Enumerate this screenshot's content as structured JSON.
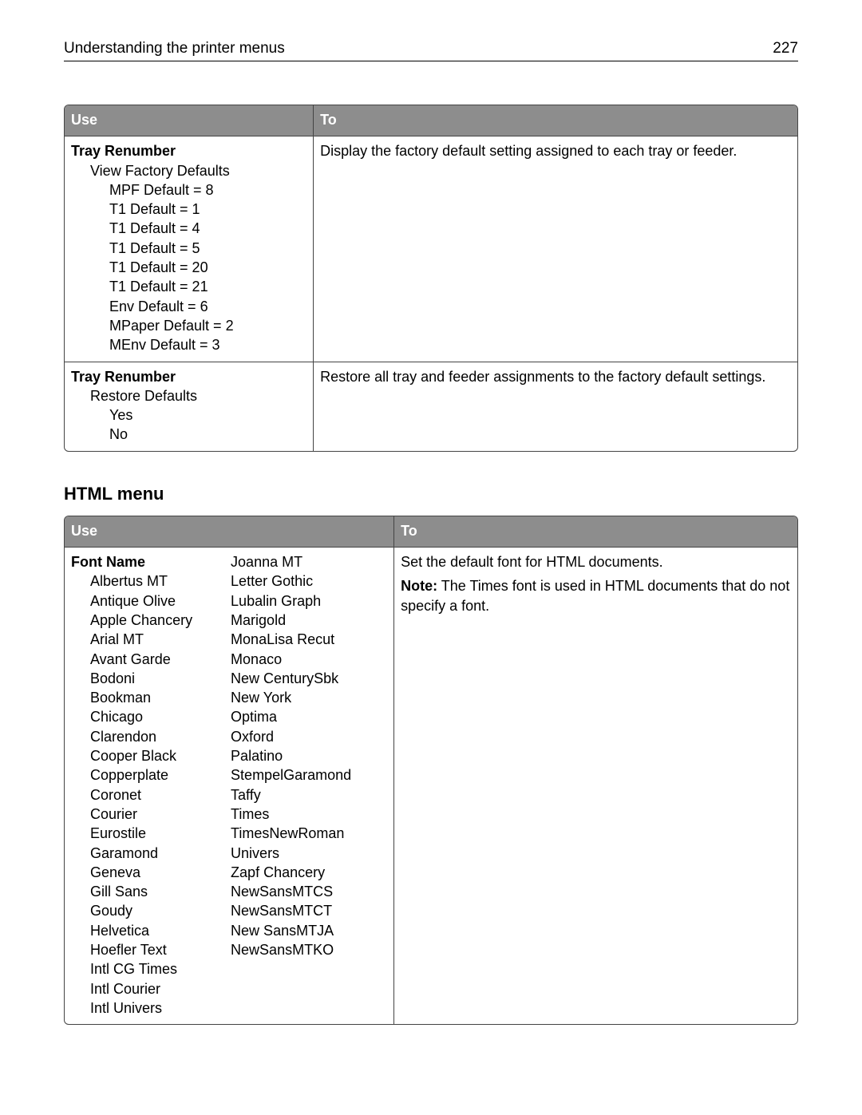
{
  "header": {
    "title": "Understanding the printer menus",
    "page_number": "227"
  },
  "table1": {
    "columns": {
      "use": "Use",
      "to": "To"
    },
    "rows": [
      {
        "use": {
          "title": "Tray Renumber",
          "sub": "View Factory Defaults",
          "items": [
            "MPF Default = 8",
            "T1 Default = 1",
            "T1 Default = 4",
            "T1 Default = 5",
            "T1 Default = 20",
            "T1 Default = 21",
            "Env Default = 6",
            "MPaper Default = 2",
            "MEnv Default = 3"
          ]
        },
        "to": "Display the factory default setting assigned to each tray or feeder."
      },
      {
        "use": {
          "title": "Tray Renumber",
          "sub": "Restore Defaults",
          "items": [
            "Yes",
            "No"
          ]
        },
        "to": "Restore all tray and feeder assignments to the factory default settings."
      }
    ]
  },
  "section2_title": "HTML menu",
  "table2": {
    "columns": {
      "use": "Use",
      "to": "To"
    },
    "row": {
      "use": {
        "title": "Font Name",
        "col1": [
          "Albertus MT",
          "Antique Olive",
          "Apple Chancery",
          "Arial MT",
          "Avant Garde",
          "Bodoni",
          "Bookman",
          "Chicago",
          "Clarendon",
          "Cooper Black",
          "Copperplate",
          "Coronet",
          "Courier",
          "Eurostile",
          "Garamond",
          "Geneva",
          "Gill Sans",
          "Goudy",
          "Helvetica",
          "Hoefler Text",
          "Intl CG Times",
          "Intl Courier",
          "Intl Univers"
        ],
        "col2": [
          "Joanna MT",
          "Letter Gothic",
          "Lubalin Graph",
          "Marigold",
          "MonaLisa Recut",
          "Monaco",
          "New CenturySbk",
          "New York",
          "Optima",
          "Oxford",
          "Palatino",
          "StempelGaramond",
          "Taffy",
          "Times",
          "TimesNewRoman",
          "Univers",
          "Zapf Chancery",
          "NewSansMTCS",
          "NewSansMTCT",
          "New SansMTJA",
          "NewSansMTKO"
        ]
      },
      "to": {
        "line1": "Set the default font for HTML documents.",
        "note_label": "Note:",
        "note_text": " The Times font is used in HTML documents that do not specify a font."
      }
    }
  }
}
